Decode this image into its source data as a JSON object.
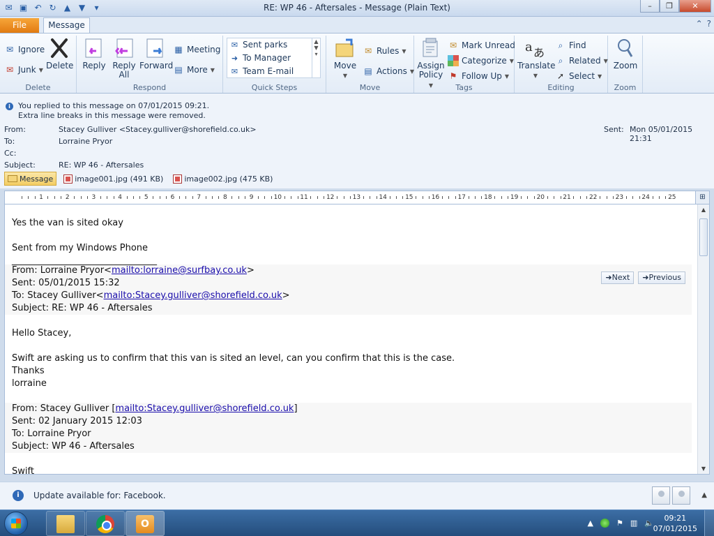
{
  "window": {
    "title": "RE: WP 46 - Aftersales  -  Message (Plain Text)",
    "file_tab": "File",
    "message_tab": "Message"
  },
  "ribbon": {
    "delete_group": {
      "label": "Delete",
      "ignore": "Ignore",
      "junk": "Junk",
      "delete": "Delete"
    },
    "respond_group": {
      "label": "Respond",
      "reply": "Reply",
      "reply_all_1": "Reply",
      "reply_all_2": "All",
      "forward": "Forward",
      "meeting": "Meeting",
      "more": "More"
    },
    "quick_steps": {
      "label": "Quick Steps",
      "items": [
        "Sent parks",
        "To Manager",
        "Team E-mail"
      ]
    },
    "move_group": {
      "label": "Move",
      "move": "Move",
      "rules": "Rules",
      "actions": "Actions"
    },
    "tags_group": {
      "label": "Tags",
      "assign_1": "Assign",
      "assign_2": "Policy",
      "mark_unread": "Mark Unread",
      "categorize": "Categorize",
      "follow_up": "Follow Up"
    },
    "editing_group": {
      "label": "Editing",
      "translate": "Translate",
      "find": "Find",
      "related": "Related",
      "select": "Select"
    },
    "zoom_group": {
      "label": "Zoom",
      "zoom": "Zoom"
    }
  },
  "header": {
    "info_line1": "You replied to this message on 07/01/2015 09:21.",
    "info_line2": "Extra line breaks in this message were removed.",
    "from_label": "From:",
    "from_value": "Stacey Gulliver <Stacey.gulliver@shorefield.co.uk>",
    "to_label": "To:",
    "to_value": "Lorraine Pryor",
    "cc_label": "Cc:",
    "cc_value": "",
    "subject_label": "Subject:",
    "subject_value": "RE: WP 46 - Aftersales",
    "sent_label": "Sent:",
    "sent_value": "Mon 05/01/2015 21:31"
  },
  "attachments": {
    "message_tab": "Message",
    "files": [
      "image001.jpg (491 KB)",
      "image002.jpg (475 KB)"
    ]
  },
  "ruler": {
    "ticks": [
      "1",
      "2",
      "3",
      "4",
      "5",
      "6",
      "7",
      "8",
      "9",
      "10",
      "11",
      "12",
      "13",
      "14",
      "15",
      "16",
      "17",
      "18",
      "19",
      "20",
      "21",
      "22",
      "23",
      "24",
      "25"
    ]
  },
  "body": {
    "line1": "Yes the van is sited okay",
    "line2": "Sent from my Windows Phone",
    "separator": "________________________________",
    "q1_from_prefix": "From: Lorraine Pryor<",
    "q1_from_link": "mailto:lorraine@surfbay.co.uk",
    "q1_from_suffix": ">",
    "q1_sent": "Sent: 05/01/2015 15:32",
    "q1_to_prefix": "To: Stacey Gulliver<",
    "q1_to_link": "mailto:Stacey.gulliver@shorefield.co.uk",
    "q1_to_suffix": ">",
    "q1_subject": "Subject: RE: WP 46 - Aftersales",
    "greeting": "Hello Stacey,",
    "para": "Swift are asking us to confirm that this van is sited an level, can you confirm that this is the case.",
    "thanks": "Thanks",
    "sign": "lorraine",
    "q2_from_prefix": "From: Stacey Gulliver [",
    "q2_from_link": "mailto:Stacey.gulliver@shorefield.co.uk",
    "q2_from_suffix": "]",
    "q2_sent": "Sent: 02 January 2015 12:03",
    "q2_to": "To: Lorraine Pryor",
    "q2_subject": "Subject: WP 46 - Aftersales",
    "cutoff": "Swift"
  },
  "nav": {
    "next": "Next",
    "previous": "Previous"
  },
  "status": {
    "text": "Update available for: Facebook."
  },
  "taskbar": {
    "time": "09:21",
    "date": "07/01/2015"
  }
}
